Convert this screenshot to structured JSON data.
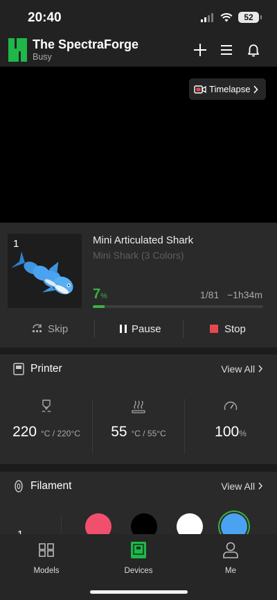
{
  "status_bar": {
    "time": "20:40",
    "battery": "52"
  },
  "header": {
    "device_name": "The SpectraForge",
    "device_status": "Busy"
  },
  "camera": {
    "timelapse_label": "Timelapse"
  },
  "job": {
    "plate_number": "1",
    "title": "Mini Articulated Shark",
    "subtitle": "Mini Shark (3 Colors)",
    "progress_value": "7",
    "progress_unit": "%",
    "progress_fraction": 0.07,
    "layers": "1/81",
    "remaining": "−1h34m",
    "skip_label": "Skip",
    "pause_label": "Pause",
    "stop_label": "Stop"
  },
  "printer": {
    "title": "Printer",
    "view_all": "View All",
    "nozzle_value": "220",
    "nozzle_unit": "°C / 220°C",
    "bed_value": "55",
    "bed_unit": "°C / 55°C",
    "speed_value": "100",
    "speed_unit": "%"
  },
  "filament": {
    "title": "Filament",
    "view_all": "View All",
    "slot_label": "1",
    "spools": [
      {
        "color": "#f0506e"
      },
      {
        "color": "#000000"
      },
      {
        "color": "#ffffff"
      },
      {
        "color": "#4aa3f0"
      }
    ]
  },
  "tabs": {
    "models": "Models",
    "devices": "Devices",
    "me": "Me"
  },
  "colors": {
    "accent": "#3cb043",
    "stop": "#e5484d",
    "background": "#1c1c1c",
    "card": "#2a2a2a"
  }
}
